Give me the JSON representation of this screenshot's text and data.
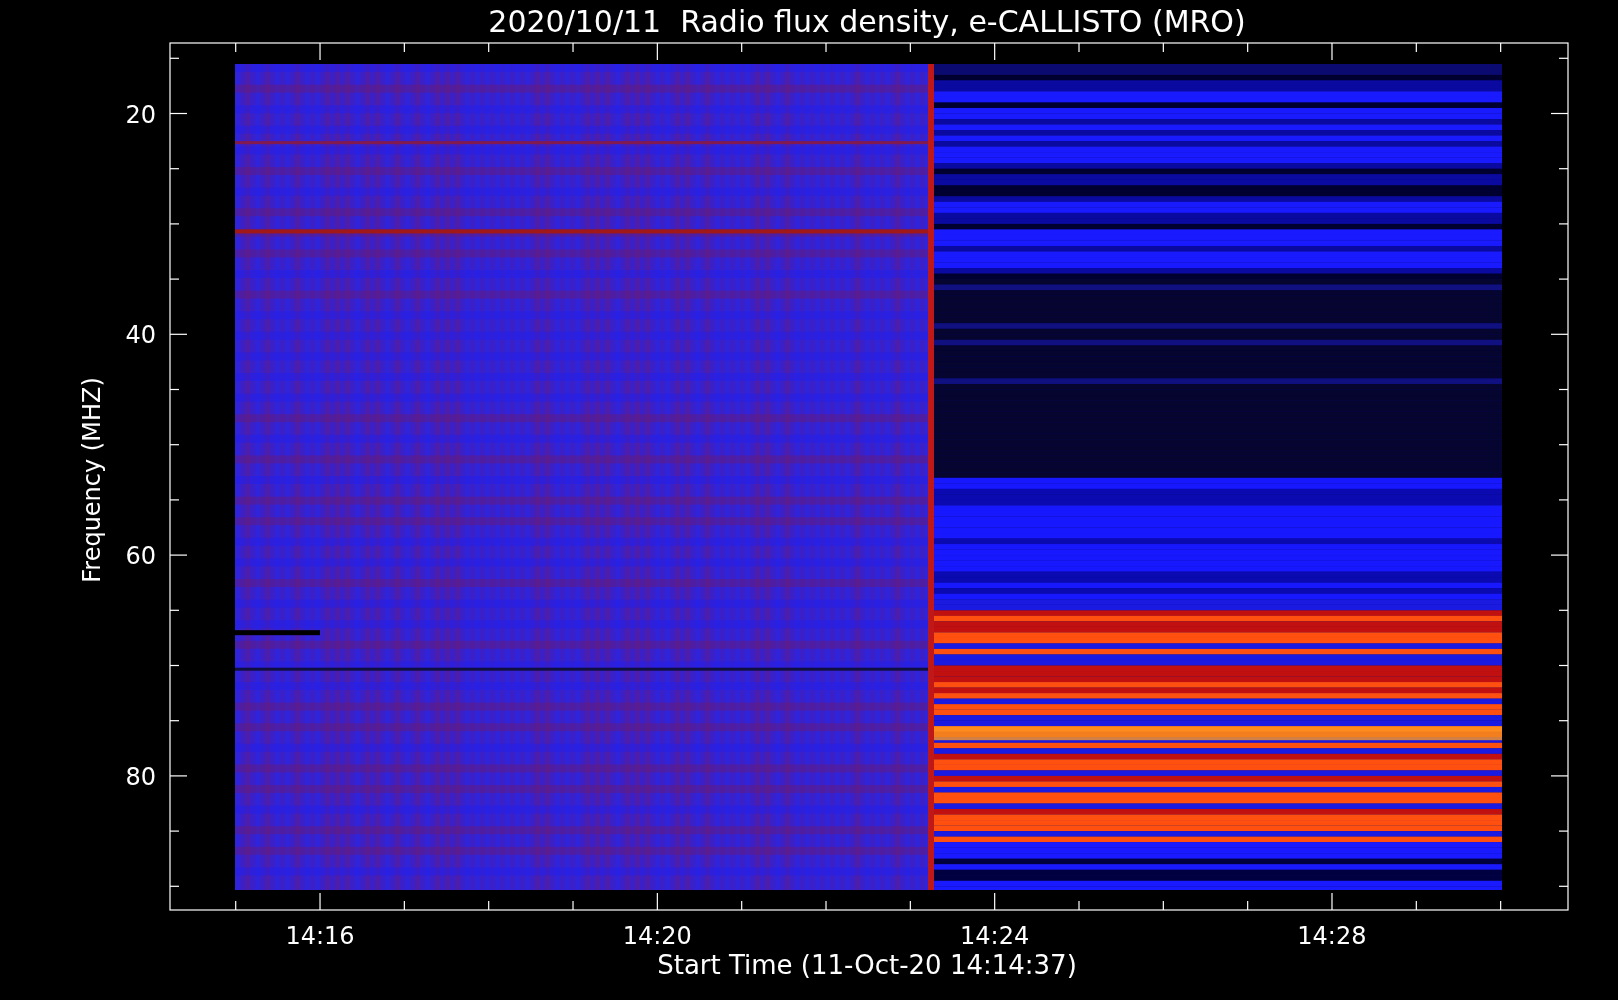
{
  "title": "2020/10/11  Radio flux density, e-CALLISTO (MRO)",
  "y_axis": {
    "label": "Frequency (MHZ)",
    "ticks": [
      "20",
      "40",
      "60",
      "80"
    ]
  },
  "x_axis": {
    "label": "Start Time (11-Oct-20 14:14:37)",
    "ticks": [
      "14:16",
      "14:20",
      "14:24",
      "14:28"
    ]
  }
}
